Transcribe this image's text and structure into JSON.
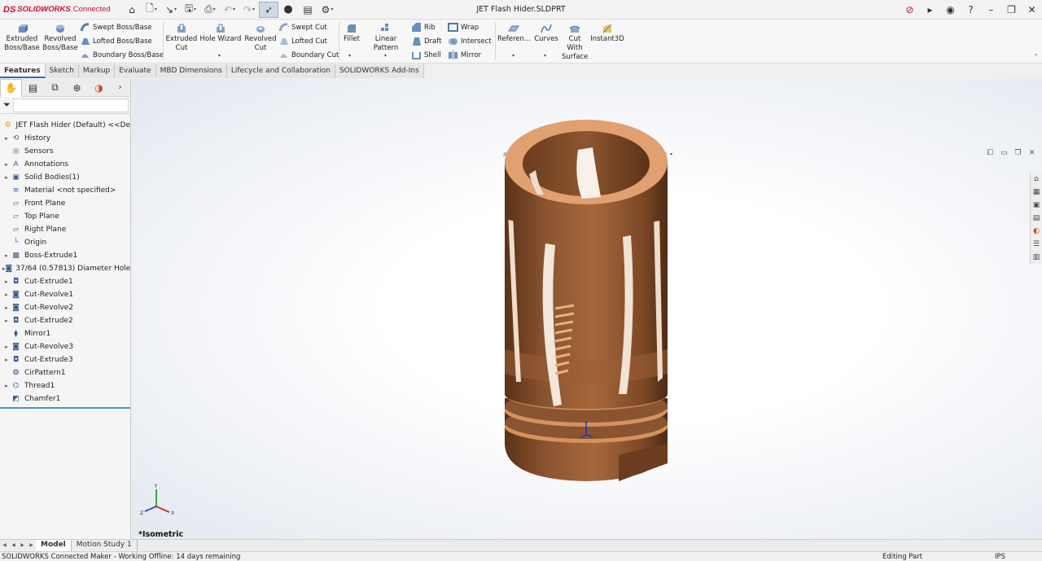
{
  "titlebar": {
    "brand_ds": "DS",
    "brand_name": "SOLIDWORKS",
    "brand_suffix": "Connected",
    "document_title": "JET Flash Hider.SLDPRT"
  },
  "ribbon": {
    "extruded_boss": "Extruded Boss/Base",
    "revolved_boss": "Revolved Boss/Base",
    "swept_boss": "Swept Boss/Base",
    "lofted_boss": "Lofted Boss/Base",
    "boundary_boss": "Boundary Boss/Base",
    "extruded_cut": "Extruded Cut",
    "hole_wizard": "Hole Wizard",
    "revolved_cut": "Revolved Cut",
    "swept_cut": "Swept Cut",
    "lofted_cut": "Lofted Cut",
    "boundary_cut": "Boundary Cut",
    "fillet": "Fillet",
    "linear_pattern": "Linear Pattern",
    "rib": "Rib",
    "draft": "Draft",
    "shell": "Shell",
    "wrap": "Wrap",
    "intersect": "Intersect",
    "mirror": "Mirror",
    "reference": "Referen...",
    "curves": "Curves",
    "cut_with_surface": "Cut With Surface",
    "instant3d": "Instant3D"
  },
  "command_tabs": [
    "Features",
    "Sketch",
    "Markup",
    "Evaluate",
    "MBD Dimensions",
    "Lifecycle and Collaboration",
    "SOLIDWORKS Add-Ins"
  ],
  "feature_tree": {
    "root": "JET Flash Hider (Default) <<De",
    "nodes": [
      {
        "label": "History",
        "icon": "history-icon",
        "expandable": true
      },
      {
        "label": "Sensors",
        "icon": "sensors-icon",
        "expandable": false
      },
      {
        "label": "Annotations",
        "icon": "annotations-icon",
        "expandable": true
      },
      {
        "label": "Solid Bodies(1)",
        "icon": "solid-bodies-icon",
        "expandable": true
      },
      {
        "label": "Material <not specified>",
        "icon": "material-icon",
        "expandable": false
      },
      {
        "label": "Front Plane",
        "icon": "plane-icon",
        "expandable": false
      },
      {
        "label": "Top Plane",
        "icon": "plane-icon",
        "expandable": false
      },
      {
        "label": "Right Plane",
        "icon": "plane-icon",
        "expandable": false
      },
      {
        "label": "Origin",
        "icon": "origin-icon",
        "expandable": false
      },
      {
        "label": "Boss-Extrude1",
        "icon": "boss-extrude-icon",
        "expandable": true
      },
      {
        "label": "37/64 (0.57813) Diameter Hole",
        "icon": "hole-icon",
        "expandable": true
      },
      {
        "label": "Cut-Extrude1",
        "icon": "cut-extrude-icon",
        "expandable": true
      },
      {
        "label": "Cut-Revolve1",
        "icon": "cut-revolve-icon",
        "expandable": true
      },
      {
        "label": "Cut-Revolve2",
        "icon": "cut-revolve-icon",
        "expandable": true
      },
      {
        "label": "Cut-Extrude2",
        "icon": "cut-extrude-icon",
        "expandable": true
      },
      {
        "label": "Mirror1",
        "icon": "mirror-icon",
        "expandable": false
      },
      {
        "label": "Cut-Revolve3",
        "icon": "cut-revolve-icon",
        "expandable": true
      },
      {
        "label": "Cut-Extrude3",
        "icon": "cut-extrude-icon",
        "expandable": true
      },
      {
        "label": "CirPattern1",
        "icon": "cirpattern-icon",
        "expandable": false
      },
      {
        "label": "Thread1",
        "icon": "thread-icon",
        "expandable": true
      },
      {
        "label": "Chamfer1",
        "icon": "chamfer-icon",
        "expandable": false
      }
    ]
  },
  "viewport": {
    "view_label": "*Isometric",
    "axis_x": "X",
    "axis_y": "Y",
    "axis_z": "Z",
    "model_color": "#a0663f"
  },
  "bottom_tabs": [
    "Model",
    "Motion Study 1"
  ],
  "status": {
    "left": "SOLIDWORKS Connected Maker - Working Offline: 14 days remaining",
    "mode": "Editing Part",
    "units": "IPS"
  }
}
